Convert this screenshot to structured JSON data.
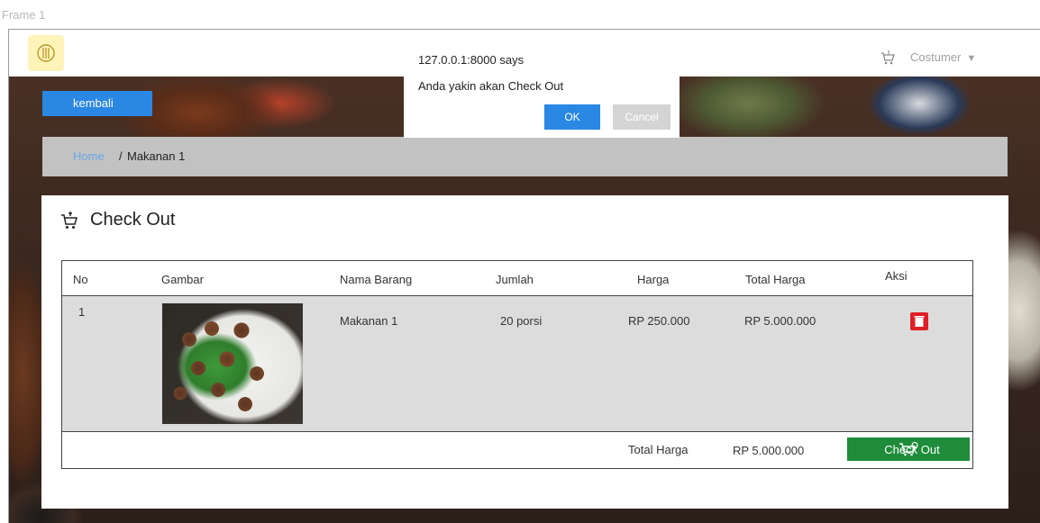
{
  "frame_label": "Frame 1",
  "header": {
    "user_menu_label": "Costumer",
    "caret": "▼"
  },
  "back_button_label": "kembali",
  "breadcrumb": {
    "home": "Home",
    "separator": "/",
    "current": "Makanan 1"
  },
  "dialog": {
    "title": "127.0.0.1:8000 says",
    "message": "Anda yakin akan Check Out",
    "ok_label": "OK",
    "cancel_label": "Cancel"
  },
  "panel": {
    "title": "Check Out",
    "columns": [
      "No",
      "Gambar",
      "Nama Barang",
      "Jumlah",
      "Harga",
      "Total Harga",
      "Aksi"
    ],
    "rows": [
      {
        "no": "1",
        "nama_barang": "Makanan 1",
        "jumlah": "20 porsi",
        "harga": "RP 250.000",
        "total_harga": "RP 5.000.000"
      }
    ],
    "footer": {
      "label": "Total Harga",
      "value": "RP 5.000.000",
      "checkout_label": "Check Out"
    }
  },
  "colors": {
    "primary_blue": "#2a87e4",
    "checkout_green": "#1e8c3a",
    "delete_red": "#e01e26",
    "breadcrumb_bg": "#c2c2c2"
  }
}
